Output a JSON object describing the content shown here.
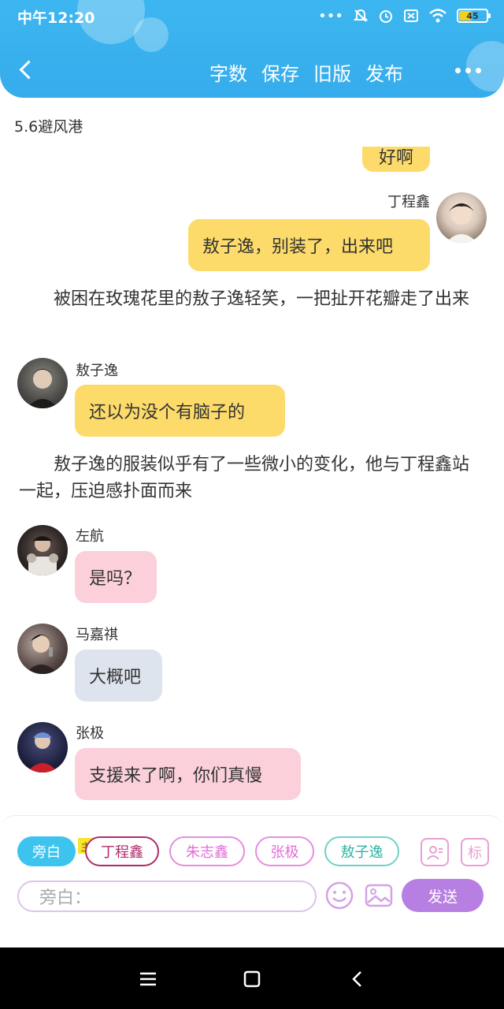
{
  "status_bar": {
    "time": "中午12:20",
    "battery": "45",
    "battery_level": 0.45,
    "icons": [
      "more-dots-icon",
      "mute-icon",
      "alarm-icon",
      "sim-icon",
      "wifi-icon",
      "battery-icon"
    ]
  },
  "nav": {
    "actions": [
      "字数",
      "保存",
      "旧版",
      "发布"
    ],
    "more_icon": "more-horizontal-icon",
    "back_icon": "chevron-left-icon"
  },
  "chapter": {
    "title": "5.6避风港"
  },
  "chat": {
    "top_cut_text": "好啊",
    "messages": [
      {
        "type": "right",
        "name": "丁程鑫",
        "text": "敖子逸，别装了，出来吧",
        "color": "yellow"
      },
      {
        "type": "narration",
        "text": "被困在玫瑰花里的敖子逸轻笑，一把扯开花瓣走了出来"
      },
      {
        "type": "left",
        "name": "敖子逸",
        "text": "还以为没个有脑子的",
        "color": "yellow"
      },
      {
        "type": "narration",
        "text": "敖子逸的服装似乎有了一些微小的变化，他与丁程鑫站一起，压迫感扑面而来"
      },
      {
        "type": "left",
        "name": "左航",
        "text": "是吗？",
        "color": "pink"
      },
      {
        "type": "left",
        "name": "马嘉祺",
        "text": "大概吧",
        "color": "grey"
      },
      {
        "type": "left",
        "name": "张极",
        "text": "支援来了啊，你们真慢",
        "color": "pink"
      }
    ]
  },
  "panel": {
    "chips": [
      "旁白",
      "丁程鑫",
      "朱志鑫",
      "张极",
      "敖子逸"
    ],
    "owner_tag": "主",
    "tool_label": "标",
    "input_placeholder": "旁白：",
    "send": "发送"
  },
  "colors": {
    "header": "#3cb6f0",
    "yellow_bubble": "#fcdb6a",
    "pink_bubble": "#fbd0da",
    "grey_bubble": "#dee4ed",
    "send": "#b77fe2"
  }
}
